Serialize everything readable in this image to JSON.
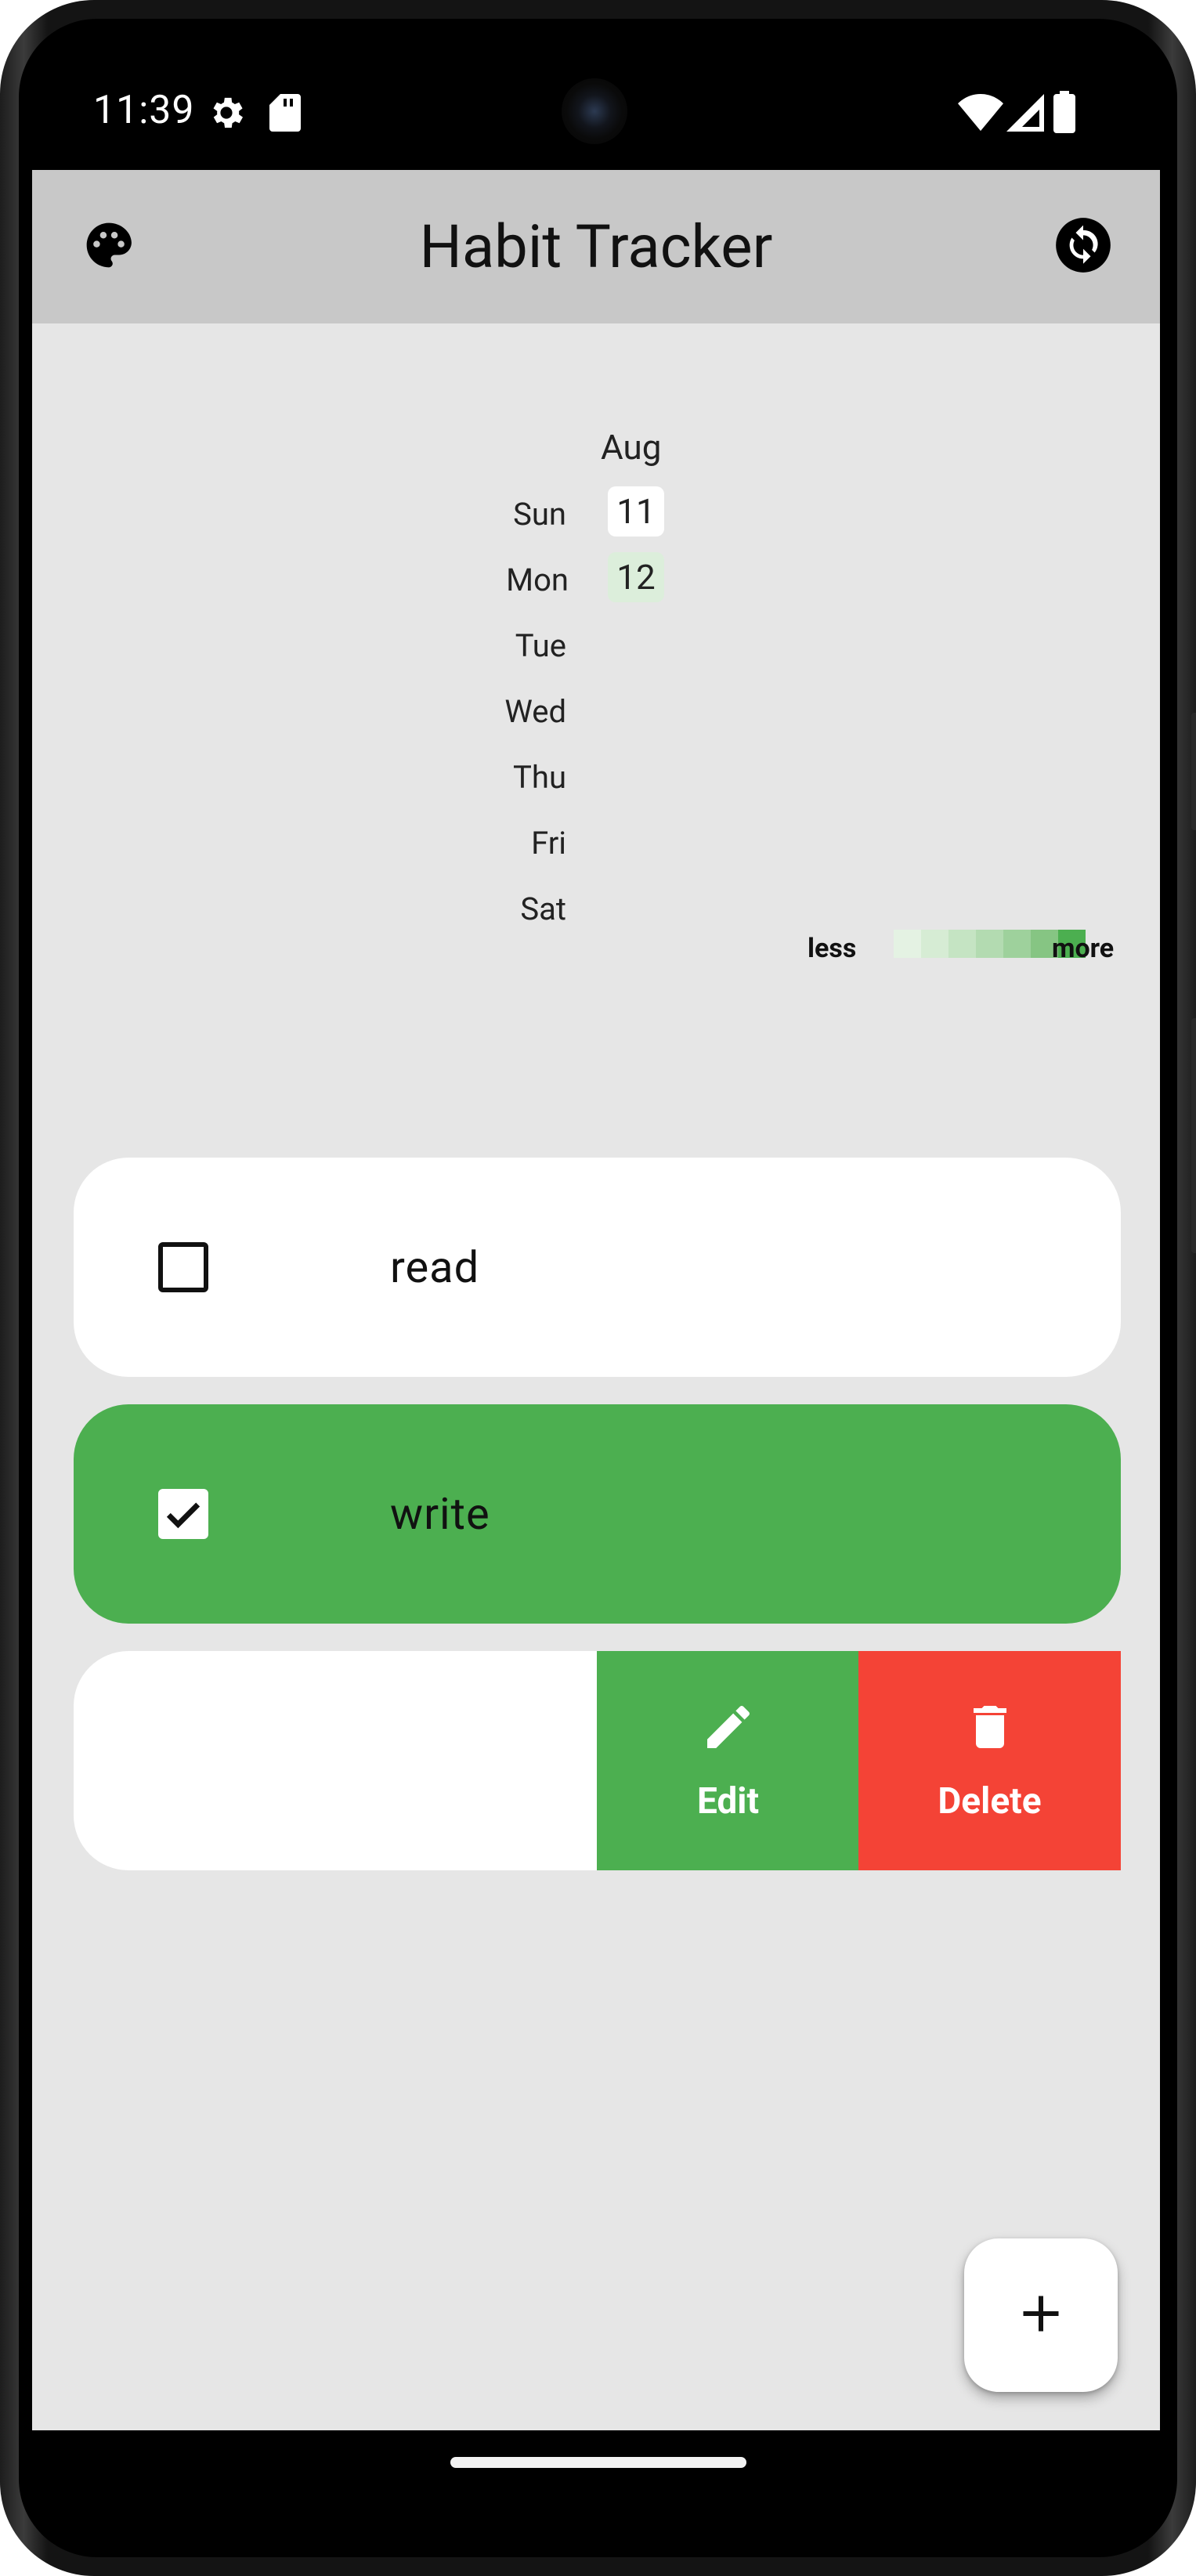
{
  "status_bar": {
    "time": "11:39",
    "icons": [
      "settings-gear-icon",
      "sd-card-icon",
      "wifi-icon",
      "cell-signal-icon",
      "battery-icon"
    ]
  },
  "app_bar": {
    "title": "Habit Tracker",
    "left_icon": "palette-icon",
    "right_icon": "sync-icon"
  },
  "heatmap": {
    "month": "Aug",
    "days": [
      "Sun",
      "Mon",
      "Tue",
      "Wed",
      "Thu",
      "Fri",
      "Sat"
    ],
    "dates": [
      {
        "day": "Sun",
        "date": "11",
        "color": "#ffffff"
      },
      {
        "day": "Mon",
        "date": "12",
        "color": "#dceedb"
      }
    ],
    "legend": {
      "less": "less",
      "more": "more",
      "colors": [
        "#e4f2e3",
        "#d6ecd4",
        "#c5e4c3",
        "#b3dbb1",
        "#9ed19c",
        "#86c583",
        "#4caf50"
      ]
    }
  },
  "habits": [
    {
      "name": "read",
      "checked": false,
      "color": "#ffffff"
    },
    {
      "name": "write",
      "checked": true,
      "color": "#4caf50"
    },
    {
      "name": "",
      "checked": false,
      "color": "#ffffff",
      "swiped": true
    }
  ],
  "swipe_actions": {
    "edit": {
      "label": "Edit",
      "color": "#4caf50",
      "icon": "pencil-icon"
    },
    "delete": {
      "label": "Delete",
      "color": "#f44336",
      "icon": "trash-icon"
    }
  },
  "fab": {
    "icon": "plus-icon"
  }
}
